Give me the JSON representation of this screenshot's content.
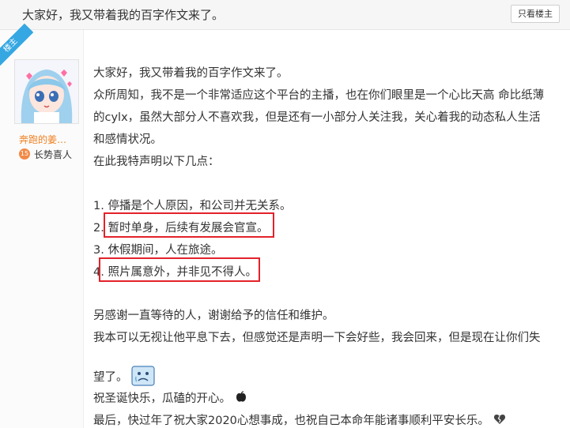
{
  "header": {
    "title": "大家好，我又带着我的百字作文来了。",
    "only_op_label": "只看楼主"
  },
  "author": {
    "badge": "楼主",
    "username": "奔跑的姜…",
    "level": "15",
    "level_title": "长势喜人",
    "avatar_icon": "anime-avatar"
  },
  "post": {
    "lines": [
      "大家好，我又带着我的百字作文来了。",
      "众所周知，我不是一个非常适应这个平台的主播，也在你们眼里是一个心比天高 命比纸薄",
      "的cylx，虽然大部分人不喜欢我，但是还有一小部分人关注我，关心着我的动态私人生活",
      "和感情状况。",
      "在此我特声明以下几点：",
      "1. 停播是个人原因，和公司并无关系。",
      "2. 暂时单身，后续有发展会官宣。",
      "3. 休假期间，人在旅途。",
      "4. 照片属意外，并非见不得人。",
      "另感谢一直等待的人，谢谢给予的信任和维护。",
      "我本可以无视让他平息下去，但感觉还是声明一下会好些，我会回来，但是现在让你们失",
      "望了。",
      "祝圣诞快乐，瓜磕的开心。",
      "最后，快过年了祝大家2020心想事成，也祝自己本命年能诸事顺利平安长乐。"
    ],
    "emoticons": [
      "sad-emoticon",
      "apple-icon",
      "broken-heart-icon"
    ],
    "highlight_color": "#e3222a"
  }
}
